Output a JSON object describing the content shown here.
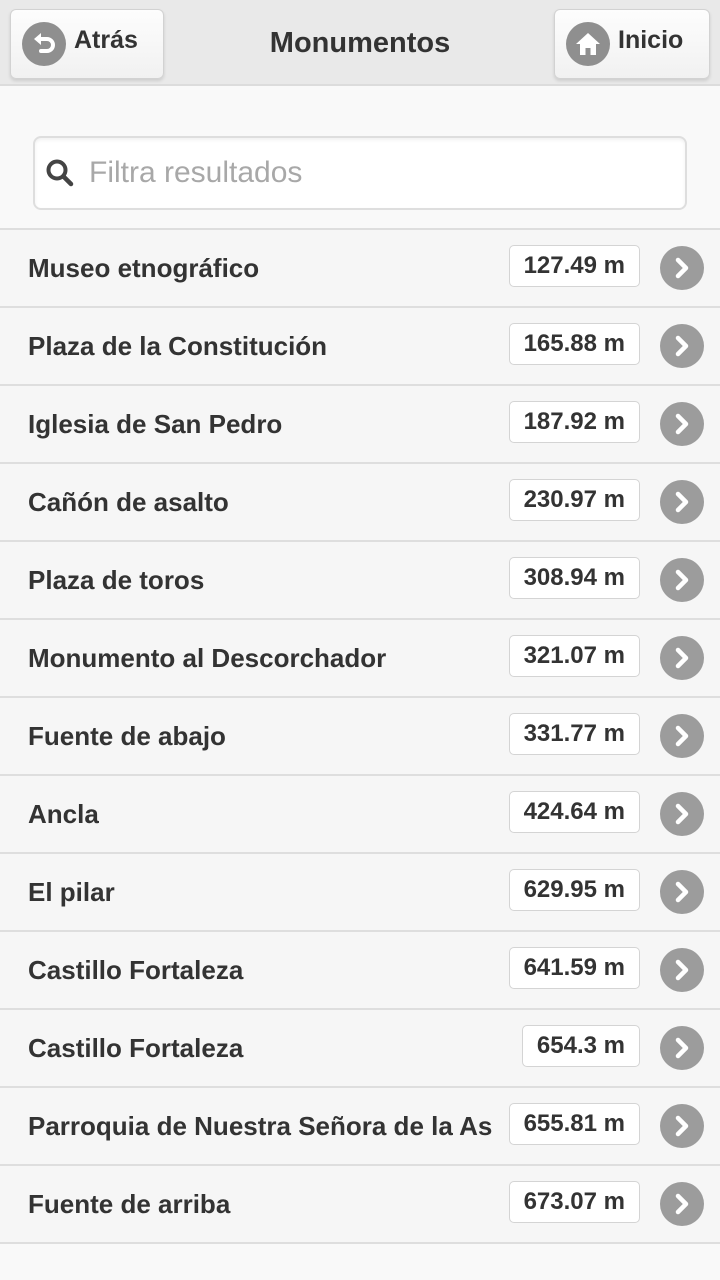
{
  "header": {
    "back_label": "Atrás",
    "title": "Monumentos",
    "home_label": "Inicio"
  },
  "search": {
    "placeholder": "Filtra resultados",
    "value": ""
  },
  "items": [
    {
      "name": "Museo etnográfico",
      "distance": "127.49 m"
    },
    {
      "name": "Plaza de la Constitución",
      "distance": "165.88 m"
    },
    {
      "name": "Iglesia de San Pedro",
      "distance": "187.92 m"
    },
    {
      "name": "Cañón de asalto",
      "distance": "230.97 m"
    },
    {
      "name": "Plaza de toros",
      "distance": "308.94 m"
    },
    {
      "name": "Monumento al Descorchador",
      "distance": "321.07 m"
    },
    {
      "name": "Fuente de abajo",
      "distance": "331.77 m"
    },
    {
      "name": "Ancla",
      "distance": "424.64 m"
    },
    {
      "name": "El pilar",
      "distance": "629.95 m"
    },
    {
      "name": "Castillo Fortaleza",
      "distance": "641.59 m"
    },
    {
      "name": "Castillo Fortaleza",
      "distance": "654.3 m"
    },
    {
      "name": "Parroquia de Nuestra Señora de la As",
      "distance": "655.81 m"
    },
    {
      "name": "Fuente de arriba",
      "distance": "673.07 m"
    }
  ],
  "icons": {
    "back": "undo-arrow-icon",
    "home": "home-icon",
    "search": "search-icon",
    "row": "chevron-right-icon"
  }
}
